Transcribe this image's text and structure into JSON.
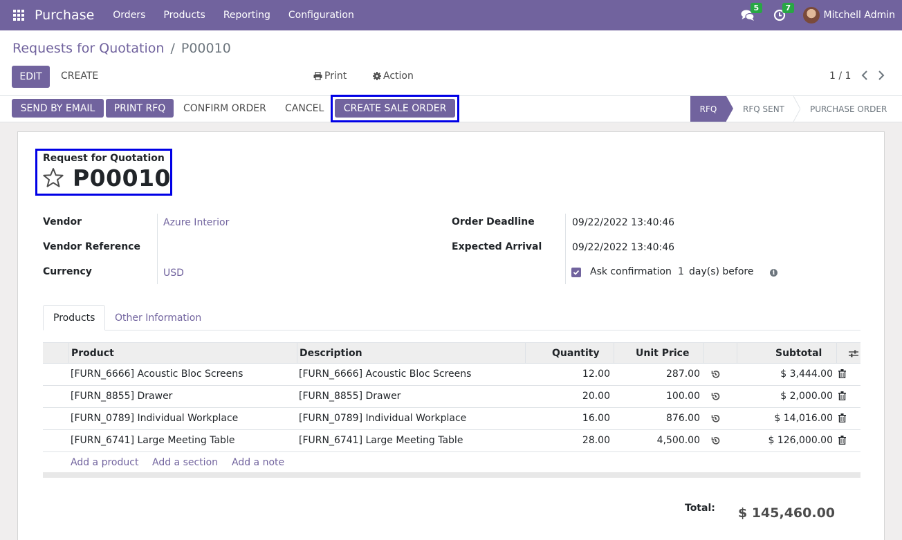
{
  "navbar": {
    "app_name": "Purchase",
    "menu": [
      "Orders",
      "Products",
      "Reporting",
      "Configuration"
    ],
    "messages_count": "5",
    "activities_count": "7",
    "user_name": "Mitchell Admin"
  },
  "breadcrumb": {
    "parent": "Requests for Quotation",
    "separator": "/",
    "current": "P00010"
  },
  "control": {
    "edit_label": "EDIT",
    "create_label": "CREATE",
    "print_label": "Print",
    "action_label": "Action",
    "pager": "1 / 1"
  },
  "statusbar": {
    "send_email": "SEND BY EMAIL",
    "print_rfq": "PRINT RFQ",
    "confirm_order": "CONFIRM ORDER",
    "cancel": "CANCEL",
    "create_sale_order": "CREATE SALE ORDER",
    "stages": [
      "RFQ",
      "RFQ SENT",
      "PURCHASE ORDER"
    ]
  },
  "form": {
    "title_label": "Request for Quotation",
    "name": "P00010",
    "vendor_label": "Vendor",
    "vendor": "Azure Interior",
    "vendor_ref_label": "Vendor Reference",
    "currency_label": "Currency",
    "currency": "USD",
    "deadline_label": "Order Deadline",
    "deadline": "09/22/2022 13:40:46",
    "arrival_label": "Expected Arrival",
    "arrival": "09/22/2022 13:40:46",
    "ask_confirm": "Ask confirmation",
    "ask_days": "1",
    "ask_suffix": "day(s) before"
  },
  "tabs": [
    "Products",
    "Other Information"
  ],
  "table": {
    "headers": [
      "Product",
      "Description",
      "Quantity",
      "Unit Price",
      "Subtotal"
    ],
    "rows": [
      {
        "product": "[FURN_6666] Acoustic Bloc Screens",
        "description": "[FURN_6666] Acoustic Bloc Screens",
        "quantity": "12.00",
        "unit_price": "287.00",
        "subtotal": "$ 3,444.00"
      },
      {
        "product": "[FURN_8855] Drawer",
        "description": "[FURN_8855] Drawer",
        "quantity": "20.00",
        "unit_price": "100.00",
        "subtotal": "$ 2,000.00"
      },
      {
        "product": "[FURN_0789] Individual Workplace",
        "description": "[FURN_0789] Individual Workplace",
        "quantity": "16.00",
        "unit_price": "876.00",
        "subtotal": "$ 14,016.00"
      },
      {
        "product": "[FURN_6741] Large Meeting Table",
        "description": "[FURN_6741] Large Meeting Table",
        "quantity": "28.00",
        "unit_price": "4,500.00",
        "subtotal": "$ 126,000.00"
      }
    ],
    "add_product": "Add a product",
    "add_section": "Add a section",
    "add_note": "Add a note"
  },
  "total": {
    "label": "Total:",
    "value": "$ 145,460.00"
  },
  "colors": {
    "brand": "#71639e",
    "highlight": "#0000e6",
    "badge": "#28a745"
  }
}
